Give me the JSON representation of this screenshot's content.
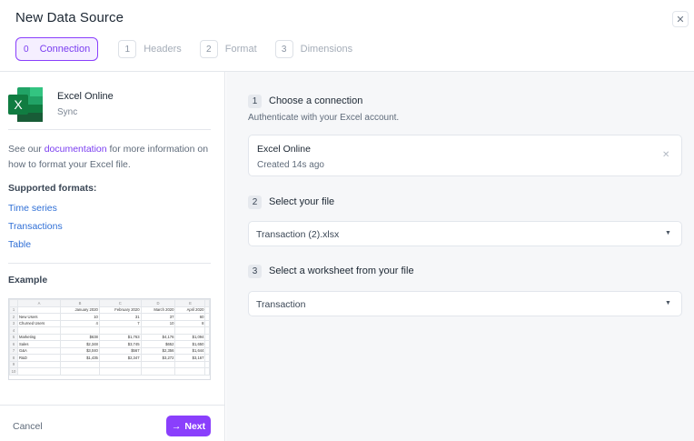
{
  "modal": {
    "title": "New Data Source",
    "close_glyph": "✕"
  },
  "steps": [
    {
      "number": "0",
      "label": "Connection",
      "active": true
    },
    {
      "number": "1",
      "label": "Headers",
      "active": false
    },
    {
      "number": "2",
      "label": "Format",
      "active": false
    },
    {
      "number": "3",
      "label": "Dimensions",
      "active": false
    }
  ],
  "sidebar": {
    "source_name": "Excel Online",
    "source_sub": "Sync",
    "logo_letter": "X",
    "help_prefix": "See our ",
    "help_link": "documentation",
    "help_suffix": " for more information on how to format your Excel file.",
    "formats_title": "Supported formats:",
    "formats": [
      "Time series",
      "Transactions",
      "Table"
    ],
    "example_title": "Example",
    "cancel_label": "Cancel",
    "next_label": "Next",
    "next_icon": "→"
  },
  "example_sheet": {
    "col_headers": [
      "",
      "A",
      "B",
      "C",
      "D",
      "E",
      ""
    ],
    "rows": [
      [
        "1",
        "",
        "January 2020",
        "February 2020",
        "March 2020",
        "April 2020",
        ""
      ],
      [
        "2",
        "New Users",
        "10",
        "31",
        "37",
        "60",
        ""
      ],
      [
        "3",
        "Churned Users",
        "4",
        "7",
        "10",
        "8",
        ""
      ],
      [
        "4",
        "",
        "",
        "",
        "",
        "",
        ""
      ],
      [
        "5",
        "Marketing",
        "$638",
        "$1,763",
        "$4,176",
        "$1,094",
        ""
      ],
      [
        "6",
        "Sales",
        "$2,348",
        "$3,745",
        "$652",
        "$1,650",
        ""
      ],
      [
        "7",
        "G&A",
        "$3,040",
        "$567",
        "$2,356",
        "$1,644",
        ""
      ],
      [
        "8",
        "R&D",
        "$1,435",
        "$2,347",
        "$3,272",
        "$3,167",
        ""
      ],
      [
        "9",
        "",
        "",
        "",
        "",
        "",
        ""
      ],
      [
        "10",
        "",
        "",
        "",
        "",
        "",
        ""
      ]
    ]
  },
  "main": {
    "section1": {
      "number": "1",
      "title": "Choose a connection",
      "desc": "Authenticate with your Excel account."
    },
    "connection": {
      "name": "Excel Online",
      "created": "Created 14s ago",
      "remove_glyph": "✕"
    },
    "section2": {
      "number": "2",
      "title": "Select your file"
    },
    "file_select": {
      "value": "Transaction (2).xlsx",
      "caret": "▼"
    },
    "section3": {
      "number": "3",
      "title": "Select a worksheet from your file"
    },
    "sheet_select": {
      "value": "Transaction",
      "caret": "▼"
    }
  },
  "colors": {
    "accent": "#8a3ffc",
    "link": "#2f6fd6",
    "excel_green": "#1d7044"
  }
}
